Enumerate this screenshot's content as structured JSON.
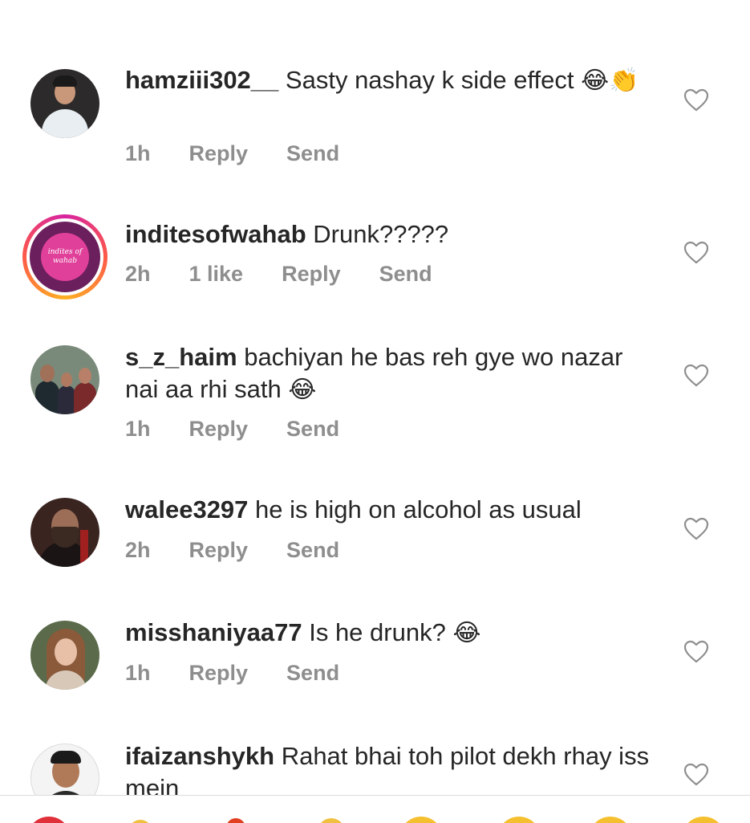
{
  "comments": [
    {
      "username": "hamziii302__",
      "text": "Sasty nashay k side effect",
      "emoji": "😂👏",
      "time": "1h",
      "likes": "",
      "reply": "Reply",
      "send": "Send"
    },
    {
      "username": "inditesofwahab",
      "text": "Drunk?????",
      "emoji": "",
      "time": "2h",
      "likes": "1 like",
      "reply": "Reply",
      "send": "Send",
      "avatar_text": "indites of wahab"
    },
    {
      "username": "s_z_haim",
      "text": "bachiyan he bas reh gye wo nazar nai aa rhi sath",
      "emoji": "😂",
      "time": "1h",
      "likes": "",
      "reply": "Reply",
      "send": "Send"
    },
    {
      "username": "walee3297",
      "text": "he is high on alcohol as usual",
      "emoji": "",
      "time": "2h",
      "likes": "",
      "reply": "Reply",
      "send": "Send"
    },
    {
      "username": "misshaniyaa77",
      "text": "Is he drunk?",
      "emoji": "😂",
      "time": "1h",
      "likes": "",
      "reply": "Reply",
      "send": "Send"
    },
    {
      "username": "ifaizanshykh",
      "text": "Rahat bhai toh pilot dekh rhay iss mein",
      "emoji": "",
      "time": "",
      "likes": "",
      "reply": "",
      "send": ""
    }
  ],
  "colors": {
    "meta_gray": "#8e8e8e",
    "text": "#262626",
    "story_ring": "#d6249f",
    "inditesofwahab_avatar_bg": "#6b1f5c",
    "inditesofwahab_avatar_inner": "#e0409a"
  },
  "icons": {
    "like": "heart-outline-icon"
  }
}
